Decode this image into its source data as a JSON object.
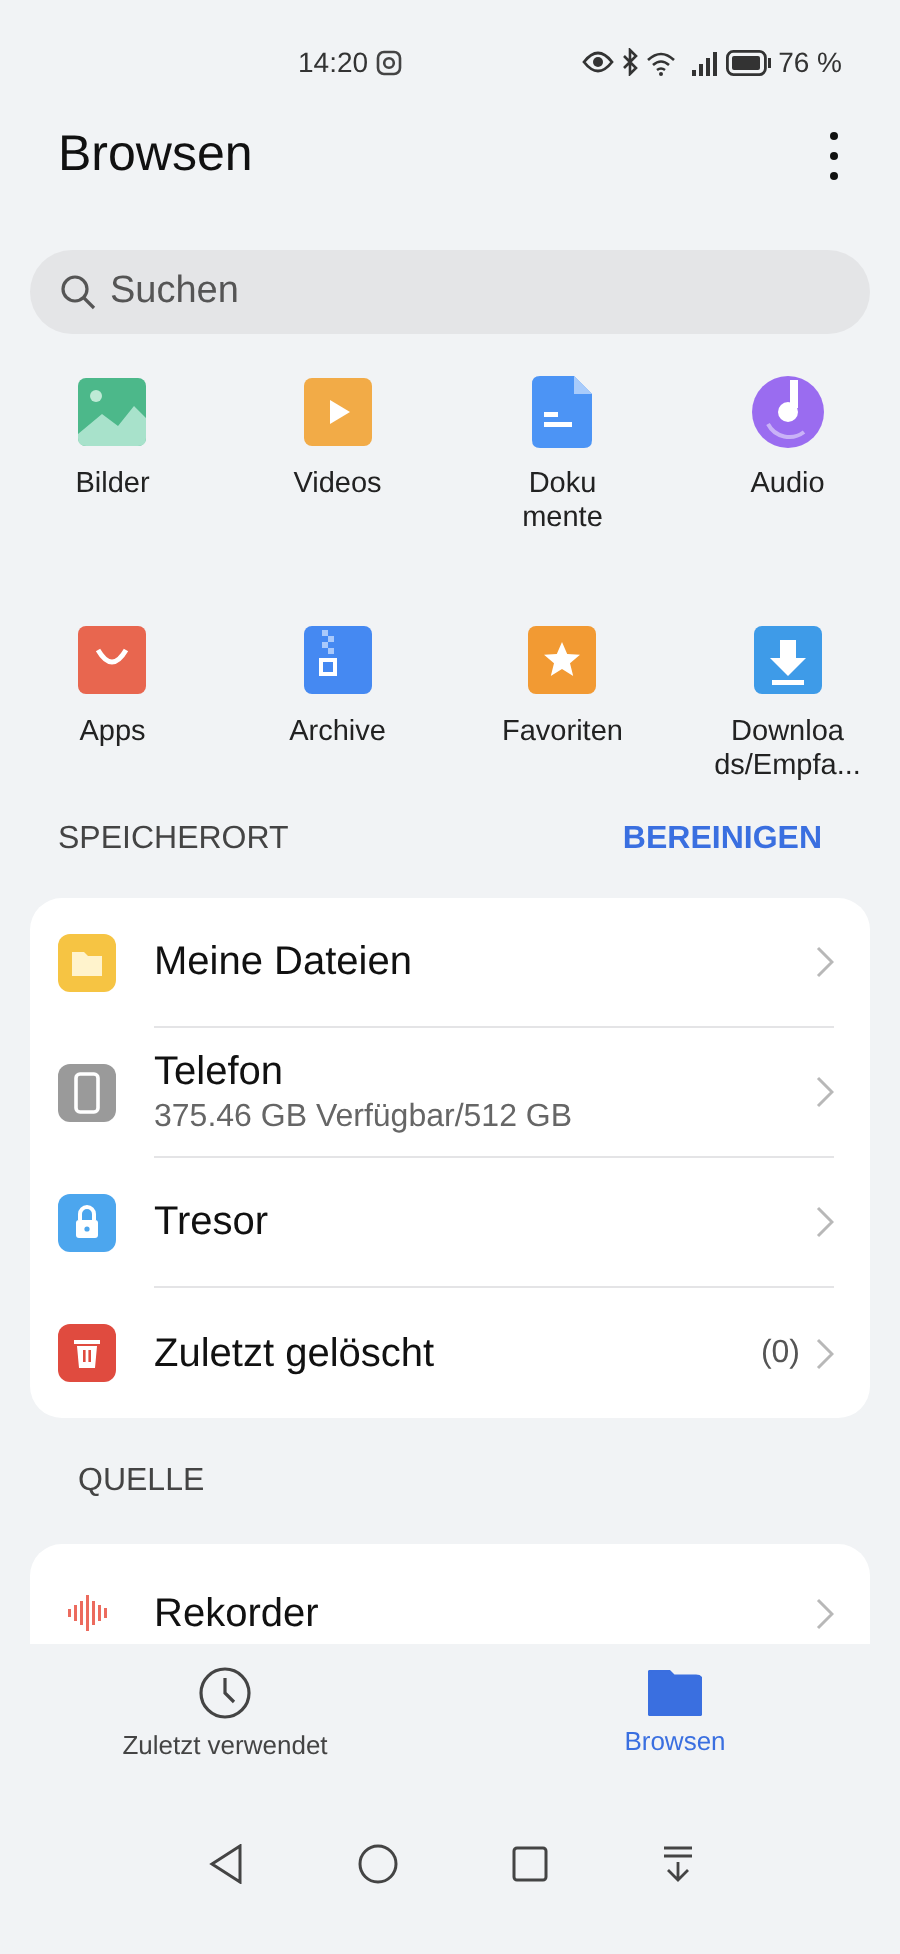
{
  "status_bar": {
    "time": "14:20",
    "battery": "76 %"
  },
  "header": {
    "title": "Browsen"
  },
  "search": {
    "placeholder": "Suchen"
  },
  "categories": [
    {
      "kind": "images",
      "label": "Bilder"
    },
    {
      "kind": "videos",
      "label": "Videos"
    },
    {
      "kind": "documents",
      "label": "Doku\nmente"
    },
    {
      "kind": "audio",
      "label": "Audio"
    },
    {
      "kind": "apps",
      "label": "Apps"
    },
    {
      "kind": "archive",
      "label": "Archive"
    },
    {
      "kind": "favorites",
      "label": "Favoriten"
    },
    {
      "kind": "downloads",
      "label": "Downloa\nds/Empfa..."
    }
  ],
  "storage_section": {
    "title": "SPEICHERORT",
    "action": "BEREINIGEN"
  },
  "storage_items": [
    {
      "kind": "folder",
      "title": "Meine Dateien"
    },
    {
      "kind": "phone",
      "title": "Telefon",
      "subtitle": "375.46 GB Verfügbar/512 GB"
    },
    {
      "kind": "lock",
      "title": "Tresor"
    },
    {
      "kind": "trash",
      "title": "Zuletzt gelöscht",
      "count": "(0)"
    }
  ],
  "source_section": {
    "title": "QUELLE"
  },
  "source_items": [
    {
      "kind": "recorder",
      "title": "Rekorder"
    }
  ],
  "bottom_tabs": [
    {
      "kind": "recent",
      "label": "Zuletzt verwendet",
      "selected": false
    },
    {
      "kind": "browse",
      "label": "Browsen",
      "selected": true
    }
  ]
}
